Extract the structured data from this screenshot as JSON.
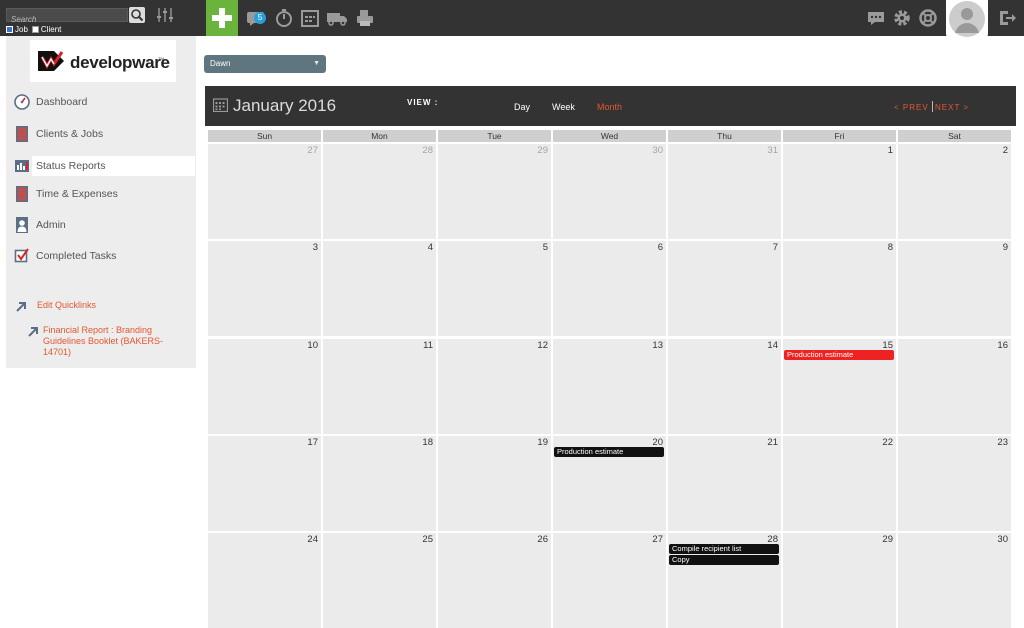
{
  "search": {
    "placeholder": "Search"
  },
  "scope": {
    "job_label": "Job",
    "client_label": "Client",
    "job_checked": true,
    "client_checked": false
  },
  "topbar": {
    "notifications_count": "5",
    "icons": [
      "add-icon",
      "chat-bubble-icon",
      "stopwatch-icon",
      "calendar-icon",
      "truck-icon",
      "printer-icon",
      "messages-icon",
      "gear-icon",
      "help-icon",
      "avatar-icon",
      "logout-icon"
    ]
  },
  "sidebar": {
    "logo_text": "developware",
    "logo_tm": "TM",
    "items": [
      {
        "label": "Dashboard",
        "icon": "gauge-icon"
      },
      {
        "label": "Clients & Jobs",
        "icon": "cabinet-icon"
      },
      {
        "label": "Status Reports",
        "icon": "bar-chart-icon"
      },
      {
        "label": "Time & Expenses",
        "icon": "cabinet-icon"
      },
      {
        "label": "Admin",
        "icon": "person-icon"
      },
      {
        "label": "Completed Tasks",
        "icon": "checkbox-icon"
      }
    ],
    "edit_quicklinks": "Edit Quicklinks",
    "quicklink": "Financial Report : Branding Guidelines Booklet (BAKERS-14701)"
  },
  "user_select": {
    "value": "Dawn"
  },
  "calendar": {
    "title": "January 2016",
    "view_label": "VIEW :",
    "views": [
      "Day",
      "Week",
      "Month"
    ],
    "active_view": "Month",
    "prev": "< PREV",
    "next": "NEXT >",
    "weekdays": [
      "Sun",
      "Mon",
      "Tue",
      "Wed",
      "Thu",
      "Fri",
      "Sat"
    ],
    "weeks": [
      [
        {
          "d": "27",
          "other": true
        },
        {
          "d": "28",
          "other": true
        },
        {
          "d": "29",
          "other": true
        },
        {
          "d": "30",
          "other": true
        },
        {
          "d": "31",
          "other": true
        },
        {
          "d": "1"
        },
        {
          "d": "2"
        }
      ],
      [
        {
          "d": "3"
        },
        {
          "d": "4"
        },
        {
          "d": "5"
        },
        {
          "d": "6"
        },
        {
          "d": "7"
        },
        {
          "d": "8"
        },
        {
          "d": "9"
        }
      ],
      [
        {
          "d": "10"
        },
        {
          "d": "11"
        },
        {
          "d": "12"
        },
        {
          "d": "13"
        },
        {
          "d": "14"
        },
        {
          "d": "15",
          "events": [
            {
              "title": "Production estimate",
              "color": "#ee2222"
            }
          ]
        },
        {
          "d": "16"
        }
      ],
      [
        {
          "d": "17"
        },
        {
          "d": "18"
        },
        {
          "d": "19"
        },
        {
          "d": "20",
          "events": [
            {
              "title": "Production estimate",
              "color": "#111111"
            }
          ]
        },
        {
          "d": "21"
        },
        {
          "d": "22"
        },
        {
          "d": "23"
        }
      ],
      [
        {
          "d": "24"
        },
        {
          "d": "25"
        },
        {
          "d": "26"
        },
        {
          "d": "27"
        },
        {
          "d": "28",
          "events": [
            {
              "title": "Compile recipient list",
              "color": "#111111"
            },
            {
              "title": "Copy",
              "color": "#111111"
            }
          ]
        },
        {
          "d": "29"
        },
        {
          "d": "30"
        }
      ]
    ]
  },
  "colors": {
    "accent": "#e4572e",
    "topbar": "#333333",
    "add_button": "#6ab33d",
    "badge": "#2a9fd8",
    "cell": "#ebebeb"
  }
}
